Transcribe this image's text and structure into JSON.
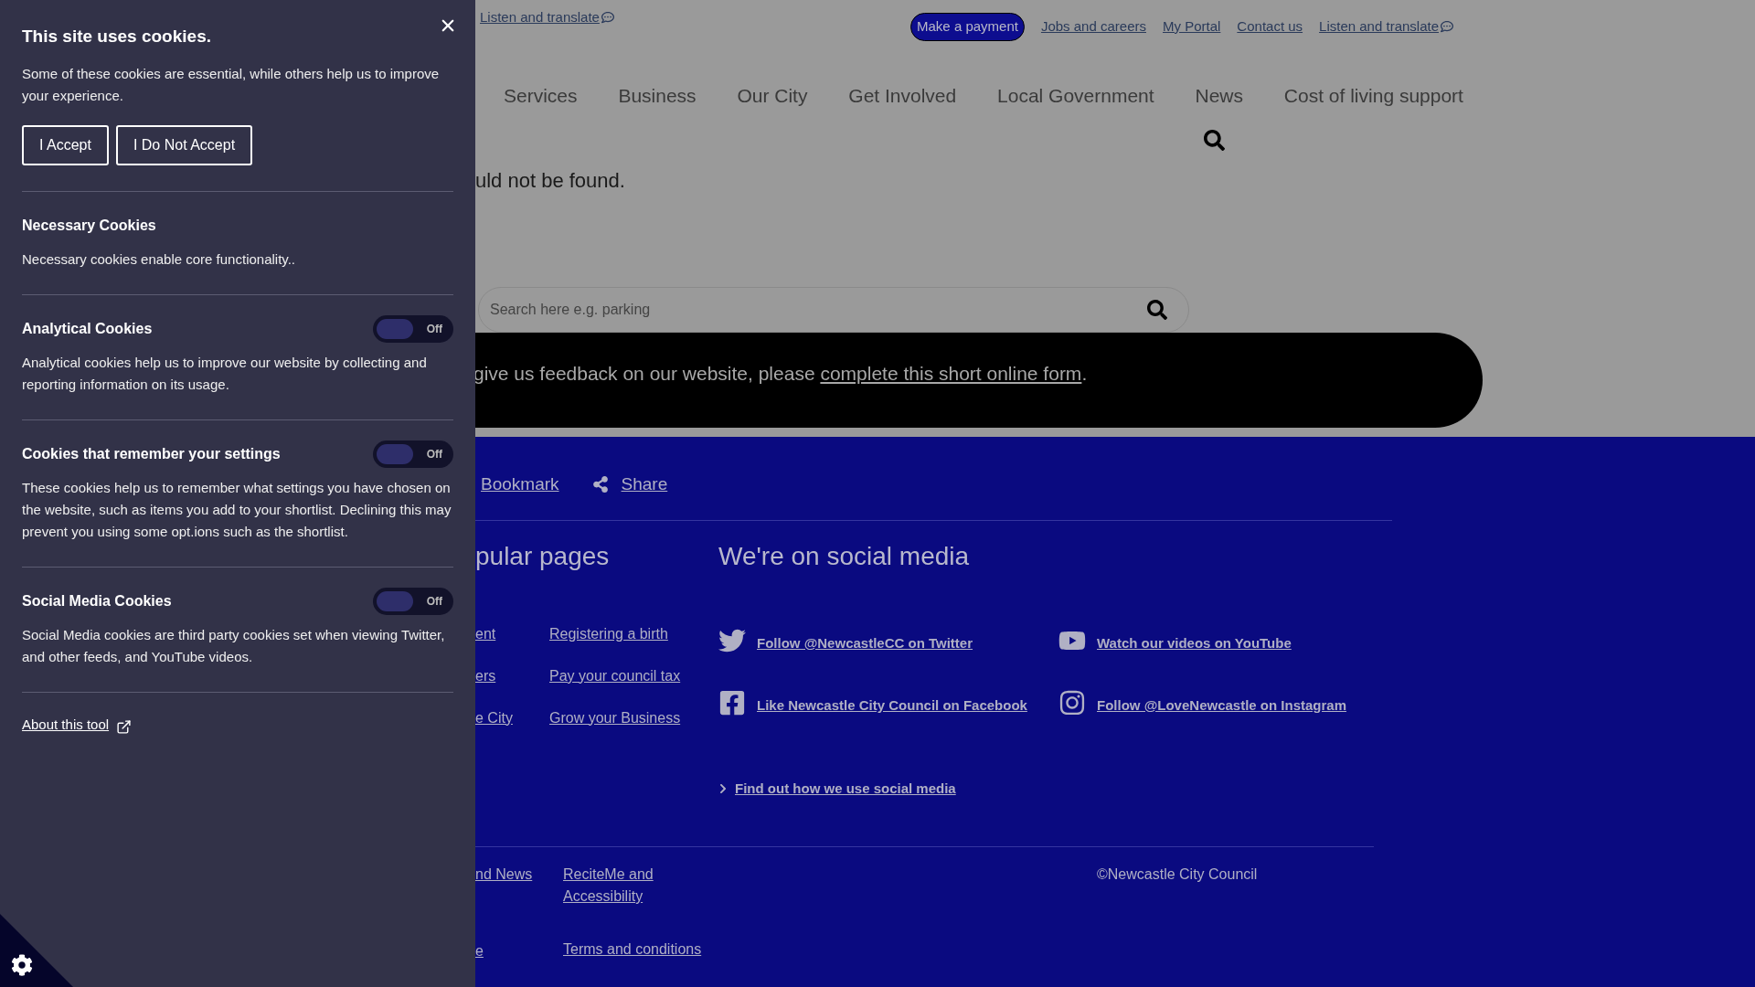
{
  "page": {
    "top_left_link": {
      "label": "Listen and translate"
    },
    "top_links": [
      {
        "label": "Make a payment",
        "kind": "button"
      },
      {
        "label": "Jobs and careers",
        "kind": "link"
      },
      {
        "label": "My Portal",
        "kind": "link"
      },
      {
        "label": "Contact us",
        "kind": "link"
      },
      {
        "label": "Listen and translate",
        "kind": "translate"
      }
    ],
    "nav": [
      "Services",
      "Business",
      "Our City",
      "Get Involved",
      "Local Government",
      "News",
      "Cost of living support"
    ],
    "message_fragment": "uld not be found.",
    "search": {
      "placeholder": "Search here e.g. parking"
    },
    "feedback": {
      "text": "give us feedback on our website, please ",
      "link": "complete this short online form",
      "after": "."
    },
    "actions": [
      {
        "label": "Bookmark",
        "kind": "plain"
      },
      {
        "label": "Share",
        "kind": "share"
      }
    ],
    "popular": {
      "heading": "pular pages",
      "column_1": [
        "ent",
        "ers",
        "e City"
      ],
      "column_2": [
        "Registering a birth",
        "Pay your council tax",
        "Grow your Business"
      ]
    },
    "social": {
      "heading": "We're on social media",
      "links": [
        {
          "label": "Follow @NewcastleCC on Twitter",
          "kind": "bird"
        },
        {
          "label": "Watch our videos on YouTube",
          "kind": "play"
        },
        {
          "label": "Like Newcastle City Council on Facebook",
          "kind": "f"
        },
        {
          "label": "Follow @LoveNewcastle on Instagram",
          "kind": "camera"
        }
      ],
      "more": "Find out how we use social media"
    },
    "footer": {
      "column_1": [
        "nd News",
        "e"
      ],
      "column_2": [
        "ReciteMe and Accessibility",
        "Terms and conditions"
      ],
      "copyright": "©Newcastle City Council"
    }
  },
  "cookie_panel": {
    "title": "This site uses cookies.",
    "intro": "Some of these cookies are essential, while others help us to improve your experience.",
    "buttons": [
      "I Accept",
      "I Do Not Accept"
    ],
    "sections": [
      {
        "title": "Necessary Cookies",
        "kind": "plain",
        "description": "Necessary cookies enable core functionality.."
      },
      {
        "title": "Analytical Cookies",
        "kind": "toggle",
        "on": false,
        "toggle_label": "Off",
        "description": "Analytical cookies help us to improve our website by collecting and reporting information on its usage."
      },
      {
        "title": "Cookies that remember your settings",
        "kind": "toggle",
        "on": false,
        "toggle_label": "Off",
        "description": "These cookies help us to remember what settings you have chosen on the website, such as items you add to your shortlist. Declining this may prevent you using some opt.ions such as the shortlist."
      },
      {
        "title": "Social Media Cookies",
        "kind": "toggle",
        "on": false,
        "toggle_label": "Off",
        "description": "Social Media cookies are third party cookies set when viewing Twitter, and other feeds, and YouTube videos."
      }
    ],
    "about_link": "About this tool"
  }
}
